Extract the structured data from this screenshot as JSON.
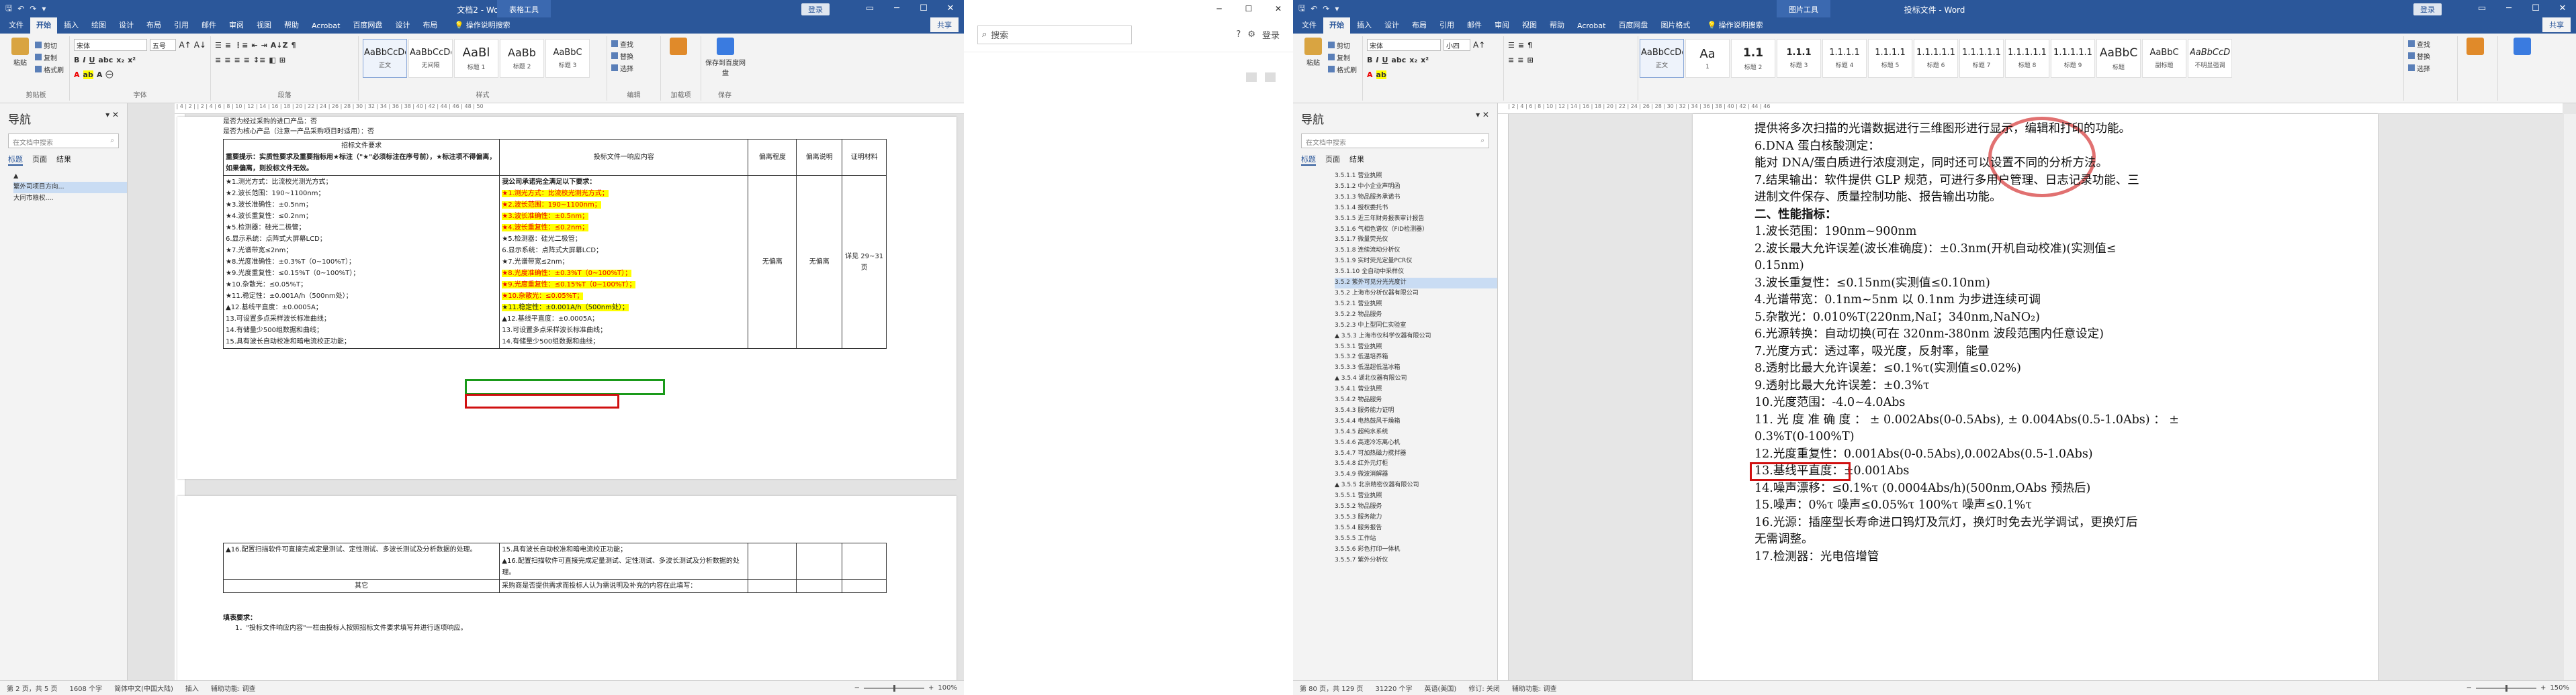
{
  "left": {
    "qat_save": "保存",
    "title": "文档2 - Word",
    "context_tab": "表格工具",
    "signin": "登录",
    "tabs": [
      "文件",
      "开始",
      "插入",
      "绘图",
      "设计",
      "布局",
      "引用",
      "邮件",
      "审阅",
      "视图",
      "帮助",
      "Acrobat",
      "百度网盘",
      "设计",
      "布局"
    ],
    "tell_me": "操作说明搜索",
    "share": "共享",
    "ribbon": {
      "clipboard": {
        "paste": "粘贴",
        "cut": "剪切",
        "copy": "复制",
        "painter": "格式刷",
        "label": "剪贴板"
      },
      "font": {
        "name": "宋体",
        "size": "五号",
        "label": "字体"
      },
      "paragraph": {
        "label": "段落"
      },
      "styles": {
        "items": [
          {
            "preview": "AaBbCcDc",
            "name": "正文"
          },
          {
            "preview": "AaBbCcDc",
            "name": "无间隔"
          },
          {
            "preview": "AaBl",
            "name": "标题 1"
          },
          {
            "preview": "AaBb",
            "name": "标题 2"
          },
          {
            "preview": "AaBbC",
            "name": "标题 3"
          }
        ],
        "label": "样式"
      },
      "editing": {
        "find": "查找",
        "replace": "替换",
        "select": "选择",
        "label": "编辑"
      },
      "addins": {
        "label": "加载项"
      },
      "save": {
        "label": "保存到百度网盘",
        "group": "保存"
      }
    },
    "nav": {
      "title": "导航",
      "search": "在文档中搜索",
      "tabs": [
        "标题",
        "页面",
        "结果"
      ],
      "tree": [
        "繁外司项目方向...",
        "大同市粮权...."
      ]
    },
    "doc": {
      "pre1": "是否为经过采购的进口产品：否",
      "pre2": "是否为核心产品（注意一产品采购项目时适用）：否",
      "head_req": "招标文件要求",
      "head_important": "重要提示：实质性要求及重要指标用★标注（\"★\"必须标注在序号前），★标注项不得偏离，如果偏离，则投标文件无效。",
      "head_resp": "投标文件一响应内容",
      "head_dev": "偏离程度",
      "head_note": "偏离说明",
      "head_proof": "证明材料",
      "req_lines": [
        "★1.测光方式：比流校光测光方式；",
        "★2.波长范围：190~1100nm；",
        "★3.波长准确性：±0.5nm；",
        "★4.波长重复性：≤0.2nm；",
        "★5.检测器：硅光二极管；",
        "6.显示系统：点阵式大屏幕LCD；",
        "★7.光谱带宽≤2nm；",
        "★8.光度准确性：±0.3%T（0~100%T）；",
        "★9.光度重复性：≤0.15%T（0~100%T）；",
        "★10.杂散光：≤0.05%T；",
        "★11.稳定性：±0.001A/h（500nm处）；",
        "▲12.基线平直度：±0.0005A；",
        "13.可设置多点采样波长标准曲线；",
        "14.有储量少500组数据和曲线；",
        "15.具有波长自动校准和暗电流校正功能；"
      ],
      "resp_head": "我公司承诺完全满足以下要求：",
      "resp_lines": [
        "★1.测光方式：比流校光测光方式；",
        "★2.波长范围：190~1100nm；",
        "★3.波长准确性：±0.5nm；",
        "★4.波长重复性：≤0.2nm；",
        "★5.检测器：硅光二极管；",
        "6.显示系统：点阵式大屏幕LCD；",
        "★7.光谱带宽≤2nm；",
        "★8.光度准确性：±0.3%T（0~100%T）；",
        "★9.光度重复性：≤0.15%T（0~100%T）；",
        "★10.杂散光：≤0.05%T；",
        "★11.稳定性：±0.001A/h（500nm处）；",
        "▲12.基线平直度：±0.0005A；",
        "13.可设置多点采样波长标准曲线；",
        "14.有储量少500组数据和曲线；"
      ],
      "dev_val": "无偏离",
      "note_val": "无偏离",
      "proof_val": "详见 29~31页",
      "p2_req": "▲16.配置扫描软件可直接完成定量测试、定性测试、多波长测试及分析数据的处理。",
      "p2_resp1": "15.具有波长自动校准和暗电流校正功能；",
      "p2_resp2": "▲16.配置扫描软件可直接完成定量测试、定性测试、多波长测试及分析数据的处理。",
      "other": "其它",
      "other_resp": "采购商是否提供需求而投标人认为需说明及补充的内容在此填写：",
      "footer_head": "填表要求：",
      "footer1": "1．\"投标文件响应内容\"一栏由投标人按照招标文件要求填写并进行逐项响应。"
    },
    "status": {
      "page": "第 2 页，共 5 页",
      "words": "1608 个字",
      "lang": "简体中文(中国大陆)",
      "insert": "插入",
      "access": "辅助功能: 调查",
      "zoom": "100%"
    }
  },
  "middle": {
    "search": "搜索",
    "help": "?",
    "settings": "⚙",
    "login": "登录"
  },
  "right": {
    "title": "投标文件 - Word",
    "context_tab": "图片工具",
    "signin": "登录",
    "tabs": [
      "文件",
      "开始",
      "插入",
      "设计",
      "布局",
      "引用",
      "邮件",
      "审阅",
      "视图",
      "帮助",
      "Acrobat",
      "百度网盘",
      "图片格式"
    ],
    "tell_me": "操作说明搜索",
    "share": "共享",
    "ribbon": {
      "font": {
        "name": "宋体",
        "size": "小四"
      },
      "styles": [
        {
          "preview": "AaBbCcDc",
          "name": "正文"
        },
        {
          "preview": "Aa",
          "name": "1"
        },
        {
          "preview": "1.1",
          "name": "标题 2"
        },
        {
          "preview": "1.1.1",
          "name": "标题 3"
        },
        {
          "preview": "1.1.1.1",
          "name": "标题 4"
        },
        {
          "preview": "1.1.1.1",
          "name": "标题 5"
        },
        {
          "preview": "1.1.1.1.1",
          "name": "标题 6"
        },
        {
          "preview": "1.1.1.1.1",
          "name": "标题 7"
        },
        {
          "preview": "1.1.1.1.1",
          "name": "标题 8"
        },
        {
          "preview": "1.1.1.1.1",
          "name": "标题 9"
        },
        {
          "preview": "AaBbC",
          "name": "标题"
        },
        {
          "preview": "AaBbC",
          "name": "副标题"
        },
        {
          "preview": "AaBbCcD",
          "name": "不明显强调"
        }
      ],
      "editing": {
        "find": "查找",
        "replace": "替换",
        "select": "选择"
      }
    },
    "nav": {
      "title": "导航",
      "search": "在文档中搜索",
      "tabs": [
        "标题",
        "页面",
        "结果"
      ],
      "tree": [
        "3.5.1.1 营业执照",
        "3.5.1.2 中小企业声明函",
        "3.5.1.3 物品服务承诺书",
        "3.5.1.4 授权委托书",
        "3.5.1.5 近三年财务报表审计报告",
        "3.5.1.6 气相色谱仪（FID检测器）",
        "3.5.1.7 微量荧光仪",
        "3.5.1.8 连续流动分析仪",
        "3.5.1.9 实时荧光定量PCR仪",
        "3.5.1.10 全自动中采样仪",
        "3.5.2 紫外可见分光光度计",
        "3.5.2 上海市分析仪器有限公司",
        "3.5.2.1 营业执照",
        "3.5.2.2 物品服务",
        "3.5.2.3 中上型同仁实验室",
        "▲ 3.5.3 上海市仪科学仪器有限公司",
        "3.5.3.1 营业执照",
        "3.5.3.2 低温培养箱",
        "3.5.3.3 低温超低温冰箱",
        "▲ 3.5.4 湖北仪器有限公司",
        "3.5.4.1 营业执照",
        "3.5.4.2 物品服务",
        "3.5.4.3 服务能力证明",
        "3.5.4.4 电热鼓风干燥箱",
        "3.5.4.5 超纯水系统",
        "3.5.4.6 高速冷冻离心机",
        "3.5.4.7 可加热磁力搅拌器",
        "3.5.4.8 红外元灯柜",
        "3.5.4.9 微波消解器",
        "▲ 3.5.5 北京精密仪器有限公司",
        "3.5.5.1 营业执照",
        "3.5.5.2 物品服务",
        "3.5.5.3 服务能力",
        "3.5.5.4 服务报告",
        "3.5.5.5 工作站",
        "3.5.5.6 彩色打印一体机",
        "3.5.5.7 紫外分析仪"
      ]
    },
    "doc": {
      "lines": [
        "提供将多次扫描的光谱数据进行三维图形进行显示，编辑和打印的功能。",
        "6.DNA 蛋白核酸测定：",
        "能对 DNA/蛋白质进行浓度测定，同时还可以设置不同的分析方法。",
        "7.结果输出：软件提供 GLP 规范，可进行多用户管理、日志记录功能、三",
        "进制文件保存、质量控制功能、报告输出功能。",
        "二、性能指标：",
        "1.波长范围：190nm~900nm",
        "2.波长最大允许误差(波长准确度)：±0.3nm(开机自动校准)(实测值≤",
        "0.15nm)",
        "3.波长重复性：≤0.15nm(实测值≤0.10nm)",
        "4.光谱带宽：0.1nm~5nm 以 0.1nm 为步进连续可调",
        "5.杂散光：0.010%T(220nm,NaI；340nm,NaNO₂)",
        "6.光源转换：自动切换(可在 320nm-380nm 波段范围内任意设定)",
        "7.光度方式：透过率，吸光度，反射率，能量",
        "8.透射比最大允许误差：≤0.1%τ(实测值≤0.02%)",
        "9.透射比最大允许误差：±0.3%τ",
        "10.光度范围：-4.0~4.0Abs",
        "11. 光 度 准 确 度 ： ± 0.002Abs(0-0.5Abs), ± 0.004Abs(0.5-1.0Abs) ： ±",
        "0.3%T(0-100%T)",
        "12.光度重复性：0.001Abs(0-0.5Abs),0.002Abs(0.5-1.0Abs)",
        "13.基线平直度：±0.001Abs",
        "14.噪声漂移：≤0.1%τ (0.0004Abs/h)(500nm,OAbs 预热后)",
        "15.噪声：0%τ 噪声≤0.05%τ 100%τ 噪声≤0.1%τ",
        "16.光源：插座型长寿命进口钨灯及氘灯，换灯时免去光学调试，更换灯后",
        "无需调整。",
        "17.检测器：光电倍增管"
      ]
    },
    "status": {
      "page": "第 80 页，共 129 页",
      "words": "31220 个字",
      "lang": "英语(美国)",
      "track": "修订: 关闭",
      "access": "辅助功能: 调查",
      "zoom": "150%"
    }
  }
}
